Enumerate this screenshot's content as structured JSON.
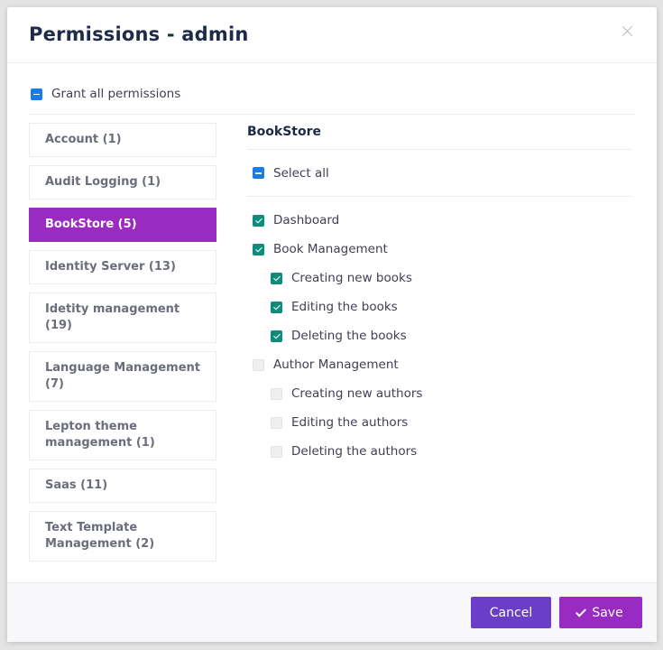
{
  "modal": {
    "title": "Permissions - admin",
    "grant_all_label": "Grant all permissions",
    "grant_all_state": "indeterminate"
  },
  "groups": [
    {
      "label": "Account (1)",
      "active": false
    },
    {
      "label": "Audit Logging (1)",
      "active": false
    },
    {
      "label": "BookStore (5)",
      "active": true
    },
    {
      "label": "Identity Server (13)",
      "active": false
    },
    {
      "label": "Idetity management (19)",
      "active": false
    },
    {
      "label": "Language Management (7)",
      "active": false
    },
    {
      "label": "Lepton theme management (1)",
      "active": false
    },
    {
      "label": "Saas (11)",
      "active": false
    },
    {
      "label": "Text Template Management (2)",
      "active": false
    }
  ],
  "panel": {
    "title": "BookStore",
    "select_all_label": "Select all",
    "select_all_state": "indeterminate",
    "permissions": [
      {
        "label": "Dashboard",
        "checked": true,
        "child": false
      },
      {
        "label": "Book Management",
        "checked": true,
        "child": false
      },
      {
        "label": "Creating new books",
        "checked": true,
        "child": true
      },
      {
        "label": "Editing the books",
        "checked": true,
        "child": true
      },
      {
        "label": "Deleting the books",
        "checked": true,
        "child": true
      },
      {
        "label": "Author Management",
        "checked": false,
        "child": false
      },
      {
        "label": "Creating new authors",
        "checked": false,
        "child": true
      },
      {
        "label": "Editing the authors",
        "checked": false,
        "child": true
      },
      {
        "label": "Deleting the authors",
        "checked": false,
        "child": true
      }
    ]
  },
  "footer": {
    "cancel_label": "Cancel",
    "save_label": "Save"
  },
  "colors": {
    "accent_purple": "#9a2bc2",
    "cancel_purple": "#6a3ec8",
    "checkbox_teal": "#0f8b7c",
    "indeterminate_blue": "#1a7ae8"
  }
}
